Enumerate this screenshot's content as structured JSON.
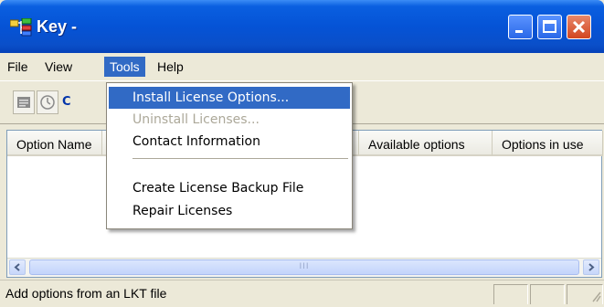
{
  "window": {
    "title": "Key -",
    "controls": [
      "minimize",
      "maximize",
      "close"
    ]
  },
  "menubar": {
    "items": [
      {
        "label": "File"
      },
      {
        "label": "View"
      },
      {
        "label": "Tools",
        "active": true
      },
      {
        "label": "Help"
      }
    ]
  },
  "toolbar": {
    "buttons": [
      {
        "icon": "properties-icon"
      },
      {
        "icon": "clock-icon"
      }
    ],
    "partial_text": "C"
  },
  "listview": {
    "columns": [
      "Option Name",
      "Available options",
      "Options in use"
    ]
  },
  "tools_menu": {
    "items": [
      {
        "label": "Install License Options...",
        "highlighted": true,
        "enabled": true
      },
      {
        "label": "Uninstall Licenses...",
        "enabled": false
      },
      {
        "label": "Contact Information",
        "enabled": true
      },
      {
        "label": "Create License Backup File",
        "enabled": true
      },
      {
        "label": "Repair Licenses",
        "enabled": true
      }
    ]
  },
  "statusbar": {
    "text": "Add options from an LKT file"
  },
  "scrollbar": {
    "thumb_grip": "III"
  },
  "colors": {
    "titlebar": "#0553d6",
    "highlight": "#316ac5",
    "disabled_text": "#aca899"
  }
}
